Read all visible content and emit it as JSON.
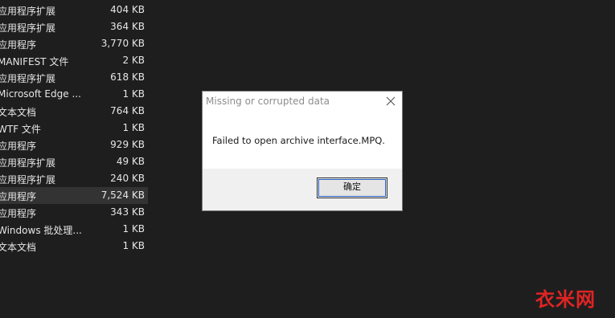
{
  "files": [
    {
      "type": "应用程序扩展",
      "size": "404 KB",
      "selected": false
    },
    {
      "type": "应用程序扩展",
      "size": "364 KB",
      "selected": false
    },
    {
      "type": "应用程序",
      "size": "3,770 KB",
      "selected": false
    },
    {
      "type": "MANIFEST 文件",
      "size": "2 KB",
      "selected": false
    },
    {
      "type": "应用程序扩展",
      "size": "618 KB",
      "selected": false
    },
    {
      "type": "Microsoft Edge ...",
      "size": "1 KB",
      "selected": false
    },
    {
      "type": "文本文档",
      "size": "764 KB",
      "selected": false
    },
    {
      "type": "WTF 文件",
      "size": "1 KB",
      "selected": false
    },
    {
      "type": "应用程序",
      "size": "929 KB",
      "selected": false
    },
    {
      "type": "应用程序扩展",
      "size": "49 KB",
      "selected": false
    },
    {
      "type": "应用程序扩展",
      "size": "240 KB",
      "selected": false
    },
    {
      "type": "应用程序",
      "size": "7,524 KB",
      "selected": true
    },
    {
      "type": "应用程序",
      "size": "343 KB",
      "selected": false
    },
    {
      "type": "Windows 批处理...",
      "size": "1 KB",
      "selected": false
    },
    {
      "type": "文本文档",
      "size": "1 KB",
      "selected": false
    }
  ],
  "dialog": {
    "title": "Missing or corrupted data",
    "message": "Failed to open archive interface.MPQ.",
    "ok_label": "确定",
    "close_icon": "close-icon"
  },
  "watermark": {
    "text": "衣米网",
    "color": "#e02424"
  },
  "colors": {
    "background": "#1e1e1e",
    "selected_row": "#333333",
    "focus_border": "#2a62c9"
  }
}
